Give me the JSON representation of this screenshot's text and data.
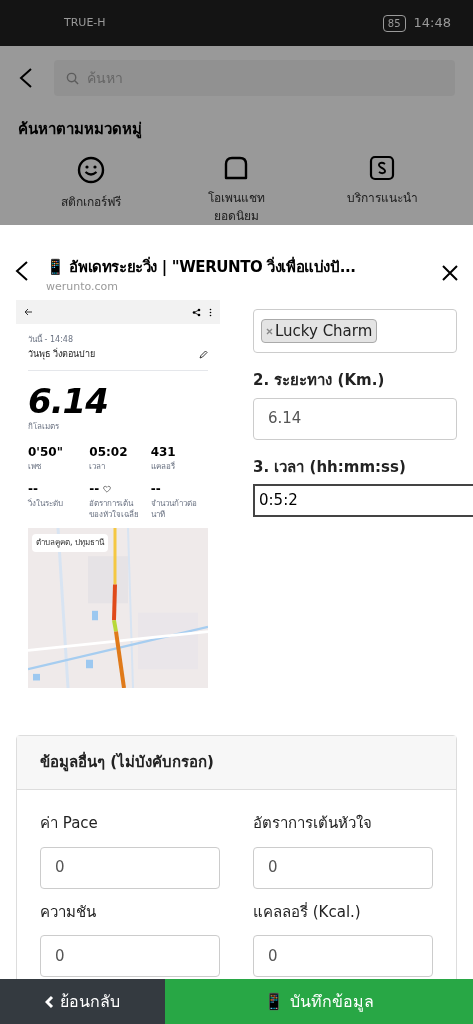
{
  "status_bar": {
    "carrier": "TRUE-H",
    "battery": "85",
    "time": "14:48"
  },
  "background_page": {
    "search": {
      "placeholder": "ค้นหา"
    },
    "section_title": "ค้นหาตามหมวดหมู่",
    "categories": [
      {
        "kind": "smile",
        "label": "สติกเกอร์ฟรี"
      },
      {
        "kind": "chat",
        "label": "โอเพนแชท\nยอดนิยม"
      },
      {
        "kind": "service",
        "label": "บริการแนะนำ"
      }
    ]
  },
  "sheet": {
    "title": "📱 อัพเดทระยะวิ่ง | \"WERUNTO วิ่งเพื่อแบ่งปั...",
    "domain": "werunto.com"
  },
  "run_screenshot": {
    "date": "วันนี้ - 14:48",
    "run_name": "วันพุธ วิ่งตอนบ่าย",
    "distance": "6.14",
    "distance_unit": "กิโลเมตร",
    "stats": [
      {
        "value": "0'50\"",
        "label": "เพซ",
        "heart": false
      },
      {
        "value": "05:02",
        "label": "เวลา",
        "heart": false
      },
      {
        "value": "431",
        "label": "แคลอรี่",
        "heart": false
      },
      {
        "value": "--",
        "label": "วิ่งในระดับ",
        "heart": false
      },
      {
        "value": "--",
        "label": "อัตราการเต้นของหัวใจเฉลี่ย",
        "heart": true
      },
      {
        "value": "--",
        "label": "จำนวนก้าวต่อนาที",
        "heart": false
      }
    ],
    "map_label": "ตำบลคูคต, ปทุมธานี"
  },
  "form": {
    "tags": [
      "Lucky Charm"
    ],
    "fields": [
      {
        "label": "2. ระยะทาง (Km.)",
        "value": "6.14",
        "focused": false
      },
      {
        "label": "3. เวลา (hh:mm:ss)",
        "value": "0:5:2",
        "focused": true
      }
    ]
  },
  "optional_card": {
    "title": "ข้อมูลอื่นๆ (ไม่บังคับกรอก)",
    "fields": [
      {
        "label": "ค่า Pace",
        "value": "0"
      },
      {
        "label": "อัตราการเต้นหัวใจ",
        "value": "0"
      },
      {
        "label": "ความชัน",
        "value": "0"
      },
      {
        "label": "แคลลอรี่ (Kcal.)",
        "value": "0"
      }
    ]
  },
  "bottom_bar": {
    "back": "ย้อนกลับ",
    "save": "📱 บันทึกข้อมูล"
  }
}
